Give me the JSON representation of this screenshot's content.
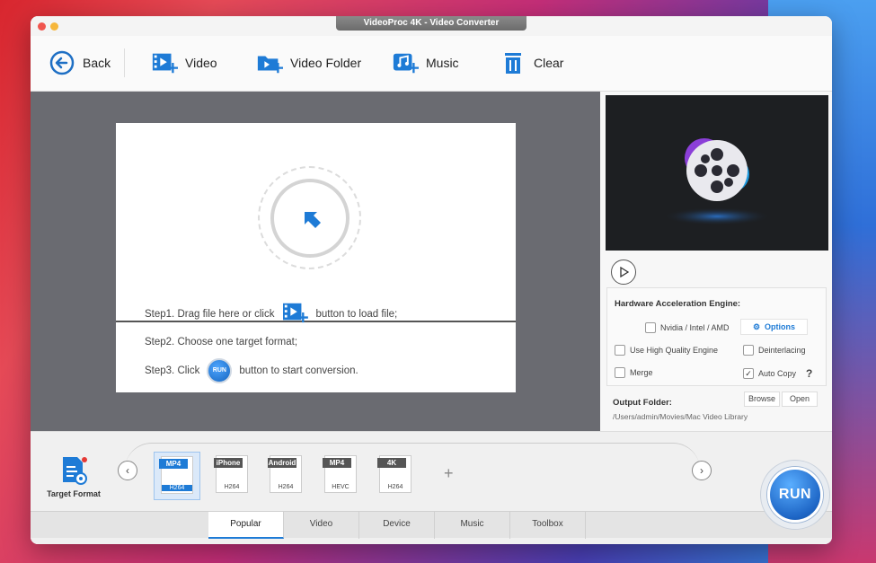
{
  "window": {
    "title": "VideoProc 4K - Video Converter"
  },
  "toolbar": {
    "back": "Back",
    "video": "Video",
    "video_folder": "Video Folder",
    "music": "Music",
    "clear": "Clear"
  },
  "drop": {
    "step1_prefix": "Step1. Drag file here or click",
    "step1_suffix": "button to load file;",
    "step2": "Step2. Choose one target format;",
    "step3_prefix": "Step3. Click",
    "step3_suffix": "button to start conversion.",
    "run_mini": "RUN"
  },
  "hardware": {
    "title": "Hardware Acceleration Engine:",
    "nvidia": "Nvidia / Intel / AMD",
    "options": "Options",
    "high_quality": "Use High Quality Engine",
    "deinterlacing": "Deinterlacing",
    "merge": "Merge",
    "auto_copy": "Auto Copy",
    "help": "?",
    "auto_copy_checked": true
  },
  "output": {
    "label": "Output Folder:",
    "path": "/Users/admin/Movies/Mac Video Library",
    "browse": "Browse",
    "open": "Open"
  },
  "target_format": {
    "label": "Target Format"
  },
  "formats": [
    {
      "tag": "MP4",
      "codec": "H264",
      "selected": true
    },
    {
      "tag": "iPhone",
      "codec": "H264",
      "selected": false
    },
    {
      "tag": "Android",
      "codec": "H264",
      "selected": false
    },
    {
      "tag": "MP4",
      "codec": "HEVC",
      "selected": false
    },
    {
      "tag": "4K",
      "codec": "H264",
      "selected": false
    }
  ],
  "tabs": [
    "Popular",
    "Video",
    "Device",
    "Music",
    "Toolbox"
  ],
  "active_tab": "Popular",
  "run": {
    "label": "RUN"
  },
  "colors": {
    "accent": "#1e7bd6",
    "drop_bg": "#6a6b71"
  }
}
